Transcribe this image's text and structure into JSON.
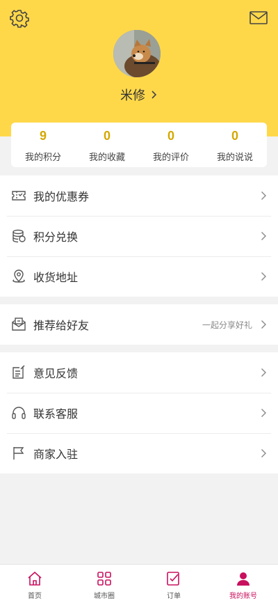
{
  "header": {
    "username": "米修",
    "colors": {
      "background": "#ffd84a",
      "accent": "#d4a800"
    }
  },
  "stats": [
    {
      "value": "9",
      "label": "我的积分"
    },
    {
      "value": "0",
      "label": "我的收藏"
    },
    {
      "value": "0",
      "label": "我的评价"
    },
    {
      "value": "0",
      "label": "我的说说"
    }
  ],
  "menu": {
    "group1": [
      {
        "label": "我的优惠券",
        "icon": "coupon-icon"
      },
      {
        "label": "积分兑换",
        "icon": "coins-icon"
      },
      {
        "label": "收货地址",
        "icon": "location-icon"
      }
    ],
    "group2": [
      {
        "label": "推荐给好友",
        "extra": "一起分享好礼",
        "icon": "share-mail-icon"
      }
    ],
    "group3": [
      {
        "label": "意见反馈",
        "icon": "feedback-icon"
      },
      {
        "label": "联系客服",
        "icon": "headset-icon"
      },
      {
        "label": "商家入驻",
        "icon": "flag-icon"
      }
    ]
  },
  "tabbar": [
    {
      "label": "首页",
      "icon": "home-icon"
    },
    {
      "label": "城市圈",
      "icon": "grid-icon"
    },
    {
      "label": "订单",
      "icon": "order-icon"
    },
    {
      "label": "我的账号",
      "icon": "user-icon",
      "active": true
    }
  ]
}
